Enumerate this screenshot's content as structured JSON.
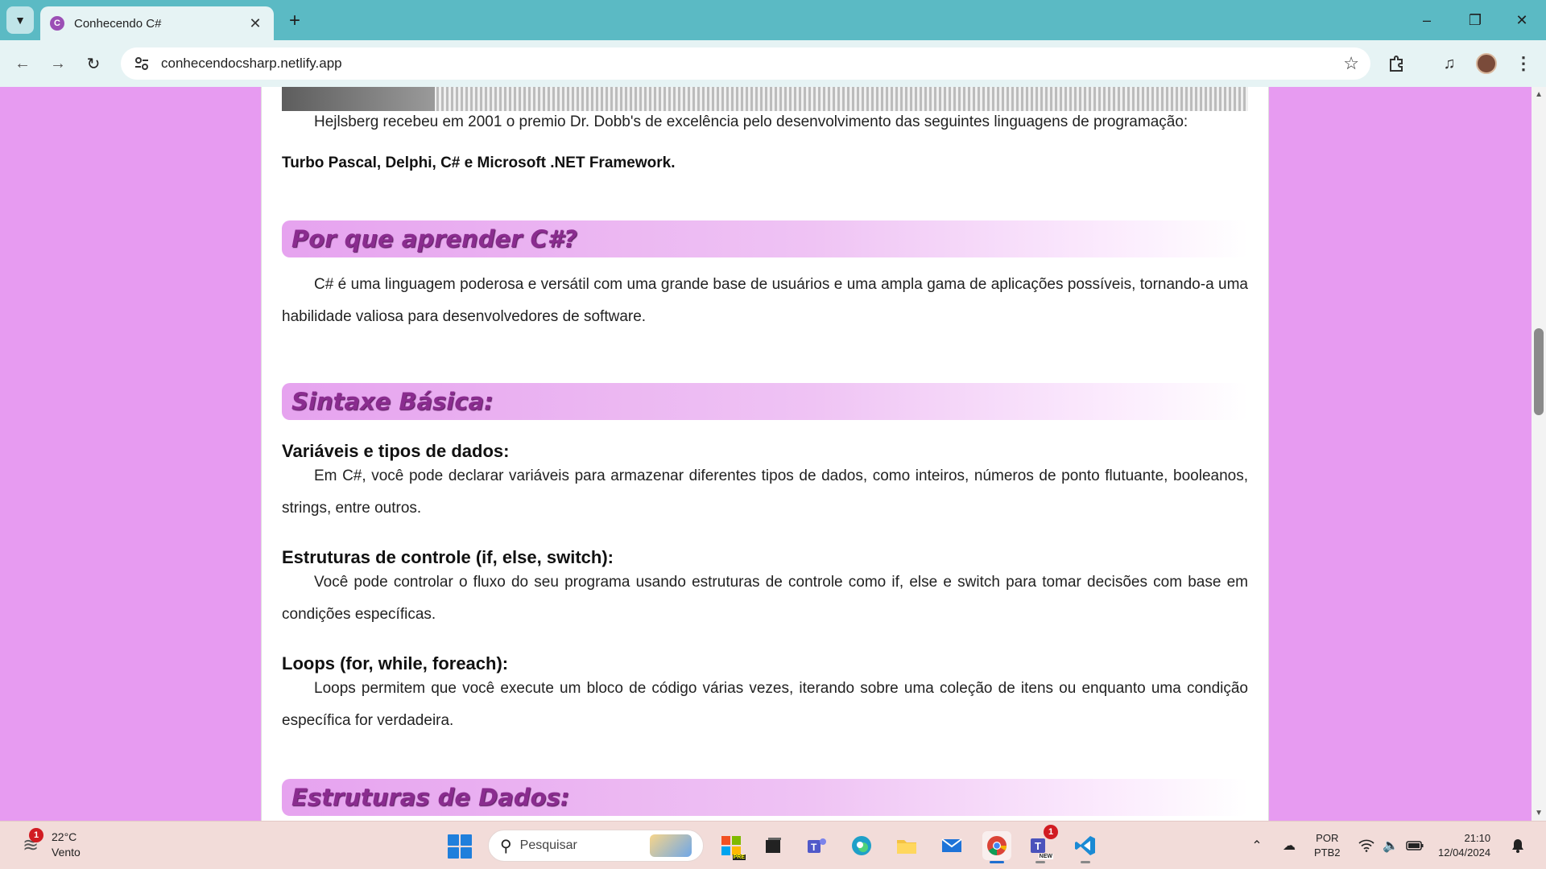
{
  "browser": {
    "tab_title": "Conhecendo C#",
    "tab_favicon": "C",
    "url": "conhecendocsharp.netlify.app"
  },
  "content": {
    "intro_paragraph": "Hejlsberg recebeu em 2001 o premio Dr. Dobb's de excelência pelo desenvolvimento das seguintes linguagens de programação:",
    "intro_bold": "Turbo Pascal, Delphi, C# e Microsoft .NET Framework.",
    "section_why_title": "Por que aprender C#?",
    "section_why_text": "C# é uma linguagem poderosa e versátil com uma grande base de usuários e uma ampla gama de aplicações possíveis, tornando-a uma habilidade valiosa para desenvolvedores de software.",
    "section_syntax_title": "Sintaxe Básica:",
    "syntax_items": [
      {
        "heading": "Variáveis e tipos de dados:",
        "text": "Em C#, você pode declarar variáveis para armazenar diferentes tipos de dados, como inteiros, números de ponto flutuante, booleanos, strings, entre outros."
      },
      {
        "heading": "Estruturas de controle (if, else, switch):",
        "text": "Você pode controlar o fluxo do seu programa usando estruturas de controle como if, else e switch para tomar decisões com base em condições específicas."
      },
      {
        "heading": "Loops (for, while, foreach):",
        "text": "Loops permitem que você execute um bloco de código várias vezes, iterando sobre uma coleção de itens ou enquanto uma condição específica for verdadeira."
      }
    ],
    "section_data_title": "Estruturas de Dados:"
  },
  "taskbar": {
    "weather_temp": "22°C",
    "weather_desc": "Vento",
    "weather_badge": "1",
    "search_placeholder": "Pesquisar",
    "teams_badge": "1",
    "teams_label": "NEW",
    "store_label": "PRE",
    "lang_line1": "POR",
    "lang_line2": "PTB2",
    "time": "21:10",
    "date": "12/04/2024"
  },
  "colors": {
    "page_background": "#e79bf1",
    "section_title": "#8a2c8f",
    "tab_strip": "#5bbac4",
    "toolbar": "#e6f3f4"
  }
}
